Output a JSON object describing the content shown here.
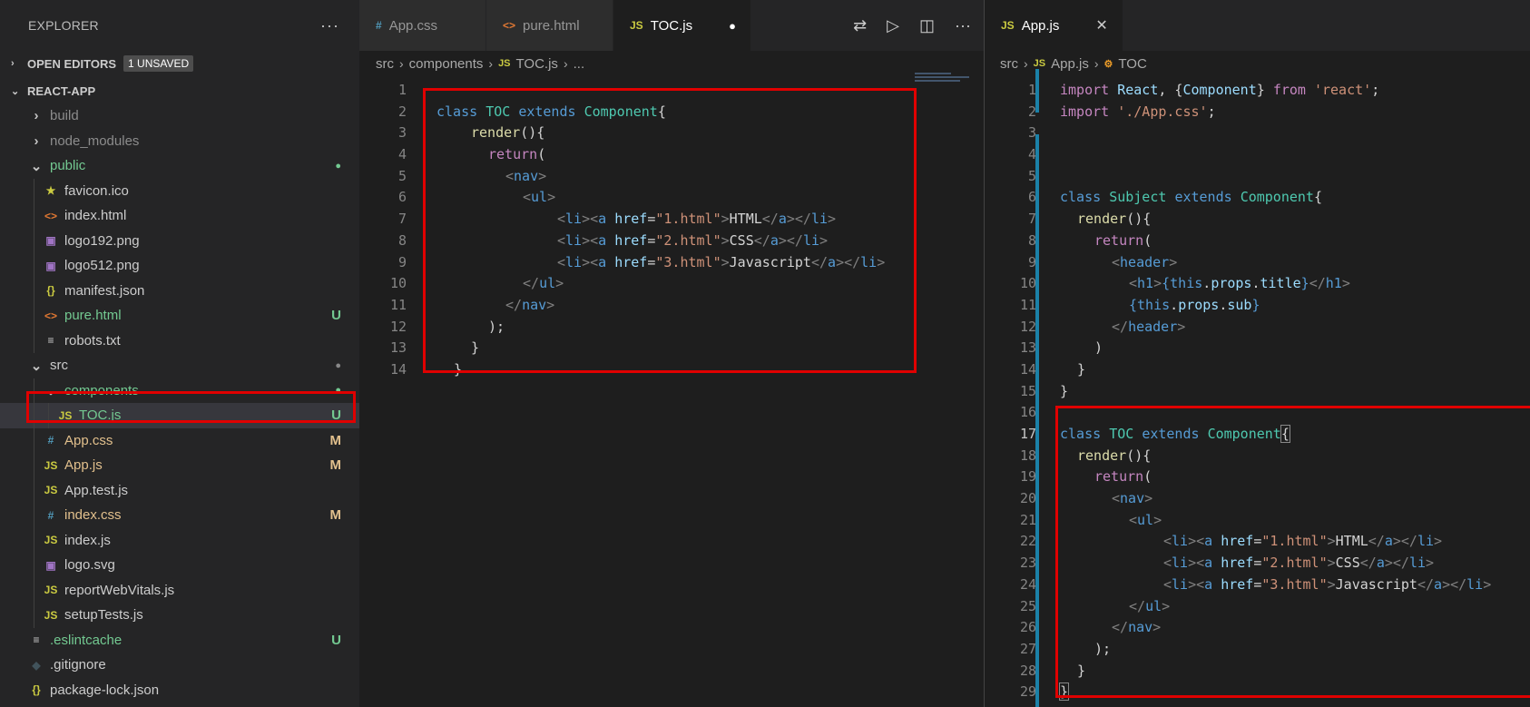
{
  "explorer": {
    "title": "EXPLORER",
    "more": "···",
    "open_editors": {
      "chevron": "›",
      "label": "OPEN EDITORS",
      "badge": "1 UNSAVED"
    },
    "project": {
      "chevron": "⌄",
      "label": "REACT-APP"
    },
    "tree": [
      {
        "label": "build",
        "chev": "›",
        "icon": "",
        "color": "#8c8c8c",
        "status": ""
      },
      {
        "label": "node_modules",
        "chev": "›",
        "icon": "",
        "color": "#8c8c8c",
        "status": ""
      },
      {
        "label": "public",
        "chev": "⌄",
        "icon": "",
        "color": "#73c991",
        "status": "●"
      },
      {
        "label": "favicon.ico",
        "chev": "",
        "icon": "★",
        "color": "#cccccc",
        "status": ""
      },
      {
        "label": "index.html",
        "chev": "",
        "icon": "<>",
        "color": "#cccccc",
        "status": ""
      },
      {
        "label": "logo192.png",
        "chev": "",
        "icon": "▣",
        "color": "#cccccc",
        "status": ""
      },
      {
        "label": "logo512.png",
        "chev": "",
        "icon": "▣",
        "color": "#cccccc",
        "status": ""
      },
      {
        "label": "manifest.json",
        "chev": "",
        "icon": "{}",
        "color": "#cccccc",
        "status": ""
      },
      {
        "label": "pure.html",
        "chev": "",
        "icon": "<>",
        "color": "#73c991",
        "status": "U"
      },
      {
        "label": "robots.txt",
        "chev": "",
        "icon": "≡",
        "color": "#cccccc",
        "status": ""
      },
      {
        "label": "src",
        "chev": "⌄",
        "icon": "",
        "color": "#cccccc",
        "status": "●"
      },
      {
        "label": "components",
        "chev": "⌄",
        "icon": "",
        "color": "#73c991",
        "status": "●"
      },
      {
        "label": "TOC.js",
        "chev": "",
        "icon": "JS",
        "color": "#73c991",
        "status": "U"
      },
      {
        "label": "App.css",
        "chev": "",
        "icon": "#",
        "color": "#e2c08d",
        "status": "M"
      },
      {
        "label": "App.js",
        "chev": "",
        "icon": "JS",
        "color": "#e2c08d",
        "status": "M"
      },
      {
        "label": "App.test.js",
        "chev": "",
        "icon": "JS",
        "color": "#cccccc",
        "status": ""
      },
      {
        "label": "index.css",
        "chev": "",
        "icon": "#",
        "color": "#e2c08d",
        "status": "M"
      },
      {
        "label": "index.js",
        "chev": "",
        "icon": "JS",
        "color": "#cccccc",
        "status": ""
      },
      {
        "label": "logo.svg",
        "chev": "",
        "icon": "▣",
        "color": "#cccccc",
        "status": ""
      },
      {
        "label": "reportWebVitals.js",
        "chev": "",
        "icon": "JS",
        "color": "#cccccc",
        "status": ""
      },
      {
        "label": "setupTests.js",
        "chev": "",
        "icon": "JS",
        "color": "#cccccc",
        "status": ""
      },
      {
        "label": ".eslintcache",
        "chev": "",
        "icon": "≡",
        "color": "#73c991",
        "status": "U"
      },
      {
        "label": ".gitignore",
        "chev": "",
        "icon": "◆",
        "color": "#cccccc",
        "status": ""
      },
      {
        "label": "package-lock.json",
        "chev": "",
        "icon": "{}",
        "color": "#cccccc",
        "status": ""
      },
      {
        "label": "package.json",
        "chev": "",
        "icon": "{}",
        "color": "#cccccc",
        "status": ""
      }
    ]
  },
  "left_editor": {
    "tabs": [
      {
        "icon": "#",
        "icon_color": "#519aba",
        "label": "App.css"
      },
      {
        "icon": "<>",
        "icon_color": "#e37933",
        "label": "pure.html"
      },
      {
        "icon": "JS",
        "icon_color": "#cbcb41",
        "label": "TOC.js",
        "dirty": "●"
      }
    ],
    "breadcrumb": [
      "src",
      "components",
      "TOC.js",
      "..."
    ]
  },
  "right_editor": {
    "tabs": [
      {
        "icon": "JS",
        "icon_color": "#cbcb41",
        "label": "App.js",
        "close": "✕"
      }
    ],
    "breadcrumb": [
      "src",
      "App.js",
      "TOC"
    ]
  },
  "colors": {
    "accent_red": "#e00000",
    "modified": "#e2c08d",
    "untracked": "#73c991",
    "git_bar": "#1b81a8"
  }
}
